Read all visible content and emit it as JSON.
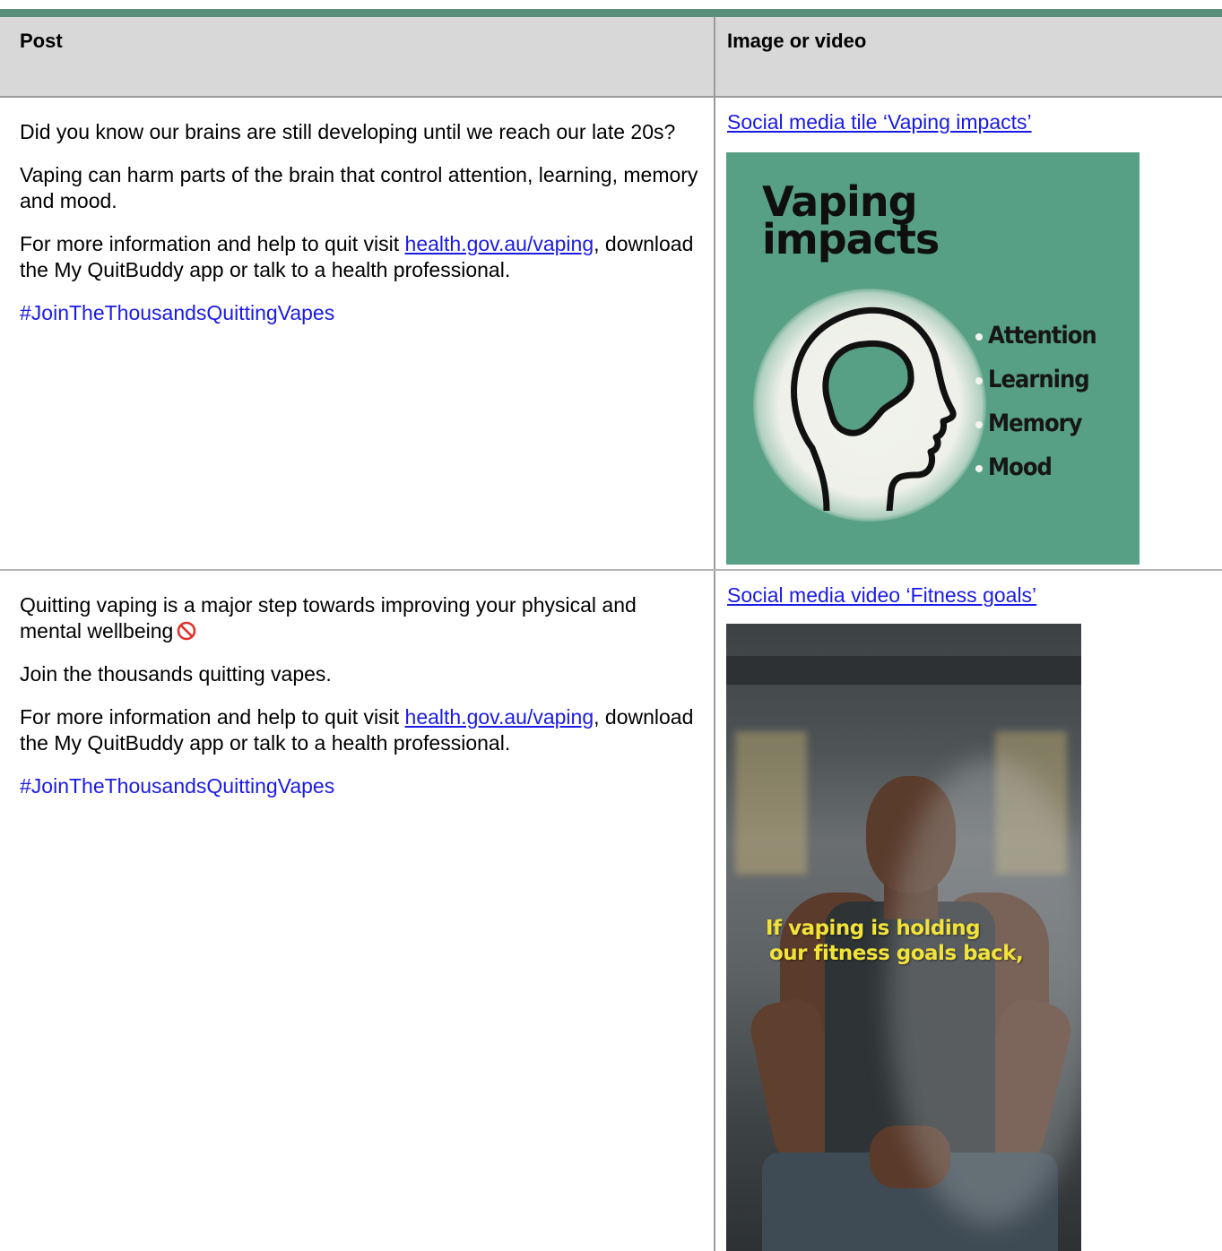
{
  "table": {
    "headers": {
      "post": "Post",
      "media": "Image or video"
    },
    "rows": [
      {
        "paragraphs": {
          "p1": "Did you know our brains are still developing until we reach our late 20s?",
          "p2": "Vaping can harm parts of the brain that control attention, learning, memory and mood.",
          "p3_before": "For more information and help to quit visit ",
          "p3_link": "health.gov.au/vaping",
          "p3_after": ", download the My QuitBuddy app or talk to a health professional.",
          "hashtag": "#JoinTheThousandsQuittingVapes"
        },
        "media_link": "Social media tile ‘Vaping impacts’",
        "tile": {
          "title_line1": "Vaping",
          "title_line2": "impacts",
          "items": [
            "Attention",
            "Learning",
            "Memory",
            "Mood"
          ]
        }
      },
      {
        "paragraphs": {
          "p1": "Quitting vaping is a major step towards improving your physical and mental wellbeing",
          "p2": "Join the thousands quitting vapes.",
          "p3_before": "For more information and help to quit visit ",
          "p3_link": "health.gov.au/vaping",
          "p3_after": ", download the My QuitBuddy app or talk to a health professional.",
          "hashtag": "#JoinTheThousandsQuittingVapes"
        },
        "media_link": "Social media video ‘Fitness goals’",
        "video": {
          "caption_line1": "If vaping is holding",
          "caption_line2": "our fitness goals back,"
        }
      }
    ]
  },
  "colors": {
    "accent_bar": "#5b8f7b",
    "header_bg": "#d8d8d8",
    "link": "#1a1ae6",
    "tile_bg": "#57a085",
    "caption": "#f2e33a"
  },
  "icons": {
    "emoji": "no-entry-icon"
  }
}
